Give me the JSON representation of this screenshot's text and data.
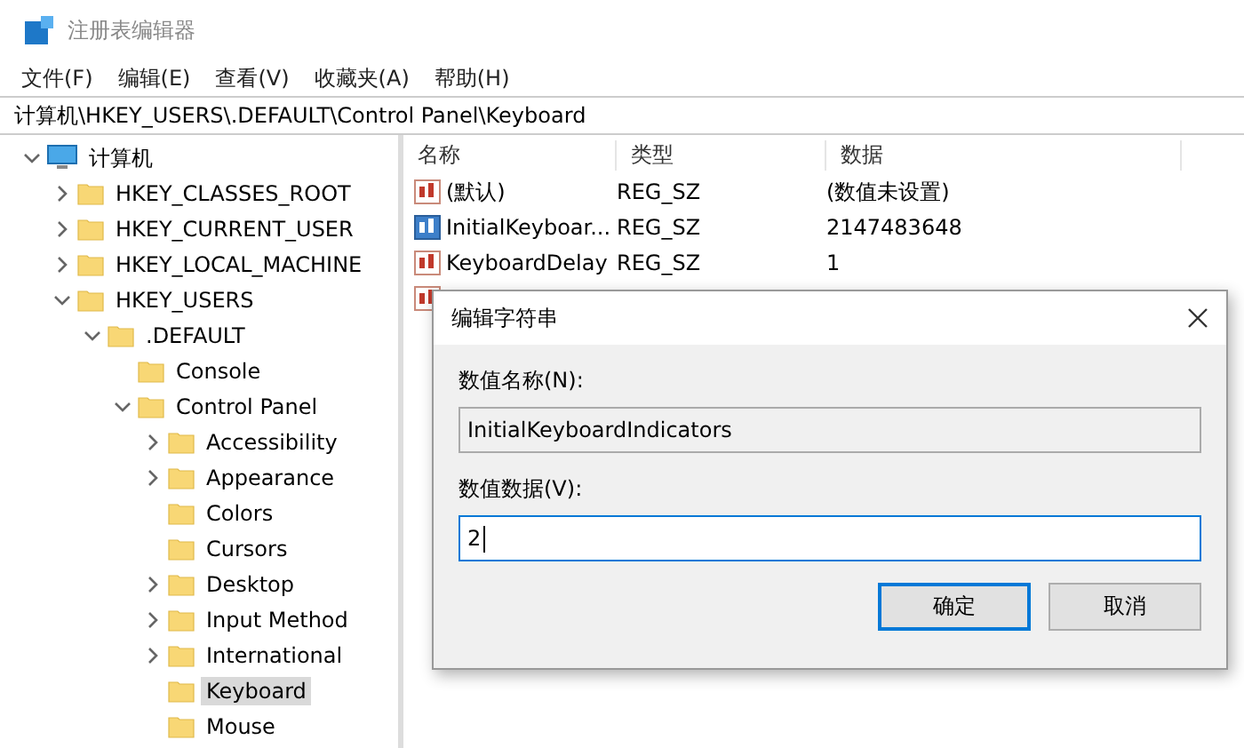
{
  "window": {
    "title": "注册表编辑器"
  },
  "menu": [
    "文件(F)",
    "编辑(E)",
    "查看(V)",
    "收藏夹(A)",
    "帮助(H)"
  ],
  "address": "计算机\\HKEY_USERS\\.DEFAULT\\Control Panel\\Keyboard",
  "tree": [
    {
      "label": "计算机",
      "kind": "computer",
      "expanded": true,
      "selected": false,
      "children": [
        {
          "label": "HKEY_CLASSES_ROOT",
          "kind": "folder",
          "expanded": false,
          "selected": false
        },
        {
          "label": "HKEY_CURRENT_USER",
          "kind": "folder",
          "expanded": false,
          "selected": false
        },
        {
          "label": "HKEY_LOCAL_MACHINE",
          "kind": "folder",
          "expanded": false,
          "selected": false
        },
        {
          "label": "HKEY_USERS",
          "kind": "folder",
          "expanded": true,
          "selected": false,
          "children": [
            {
              "label": ".DEFAULT",
              "kind": "folder",
              "expanded": true,
              "selected": false,
              "children": [
                {
                  "label": "Console",
                  "kind": "folder",
                  "selected": false
                },
                {
                  "label": "Control Panel",
                  "kind": "folder",
                  "expanded": true,
                  "selected": false,
                  "children": [
                    {
                      "label": "Accessibility",
                      "kind": "folder",
                      "expanded": false,
                      "selected": false
                    },
                    {
                      "label": "Appearance",
                      "kind": "folder",
                      "expanded": false,
                      "selected": false
                    },
                    {
                      "label": "Colors",
                      "kind": "folder",
                      "selected": false
                    },
                    {
                      "label": "Cursors",
                      "kind": "folder",
                      "selected": false
                    },
                    {
                      "label": "Desktop",
                      "kind": "folder",
                      "expanded": false,
                      "selected": false
                    },
                    {
                      "label": "Input Method",
                      "kind": "folder",
                      "expanded": false,
                      "selected": false
                    },
                    {
                      "label": "International",
                      "kind": "folder",
                      "expanded": false,
                      "selected": false
                    },
                    {
                      "label": "Keyboard",
                      "kind": "folder",
                      "selected": true
                    },
                    {
                      "label": "Mouse",
                      "kind": "folder",
                      "selected": false
                    }
                  ]
                }
              ]
            }
          ]
        }
      ]
    }
  ],
  "table": {
    "columns": [
      "名称",
      "类型",
      "数据"
    ],
    "rows": [
      {
        "name": "(默认)",
        "type": "REG_SZ",
        "data": "(数值未设置)",
        "selected": false
      },
      {
        "name": "InitialKeyboar...",
        "type": "REG_SZ",
        "data": "2147483648",
        "selected": true
      },
      {
        "name": "KeyboardDelay",
        "type": "REG_SZ",
        "data": "1",
        "selected": false
      },
      {
        "selected": false
      }
    ]
  },
  "dialog": {
    "title": "编辑字符串",
    "name_label": "数值名称(N):",
    "name_value": "InitialKeyboardIndicators",
    "data_label": "数值数据(V):",
    "data_value": "2",
    "buttons": [
      {
        "label": "确定",
        "selected": true
      },
      {
        "label": "取消",
        "selected": false
      }
    ]
  }
}
